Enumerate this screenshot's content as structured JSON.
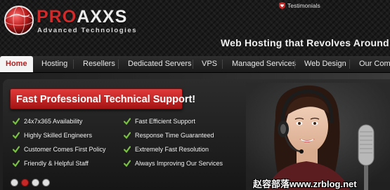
{
  "header": {
    "logo_primary": "PRO",
    "logo_secondary": "AXXS",
    "logo_tagline": "Advanced Technologies",
    "testimonials_label": "Testimonials",
    "tagline": "Web Hosting that Revolves Around"
  },
  "nav": {
    "items": [
      {
        "label": "Home"
      },
      {
        "label": "Hosting"
      },
      {
        "label": "Resellers"
      },
      {
        "label": "Dedicated Servers"
      },
      {
        "label": "VPS"
      },
      {
        "label": "Managed Services"
      },
      {
        "label": "Web Design"
      },
      {
        "label": "Our Comp"
      }
    ]
  },
  "banner": {
    "headline": "Fast Professional Technical Support!",
    "features_left": [
      "24x7x365 Availability",
      "Highly Skilled Engineers",
      "Customer Comes First Policy",
      "Friendly & Helpful Staff"
    ],
    "features_right": [
      "Fast Efficient Support",
      "Response Time Guaranteed",
      "Extremely Fast Resolution",
      "Always Improving Our Services"
    ],
    "slider_dots": 4,
    "active_dot": 2
  },
  "watermark": "赵容部落www.zrblog.net",
  "colors": {
    "brand_red": "#c62828",
    "check_green": "#7ac143",
    "nav_bg": "#222222"
  },
  "icons": {
    "testimonials": "shield-heart-icon",
    "feature": "checkmark-icon",
    "logo": "globe-icon"
  }
}
